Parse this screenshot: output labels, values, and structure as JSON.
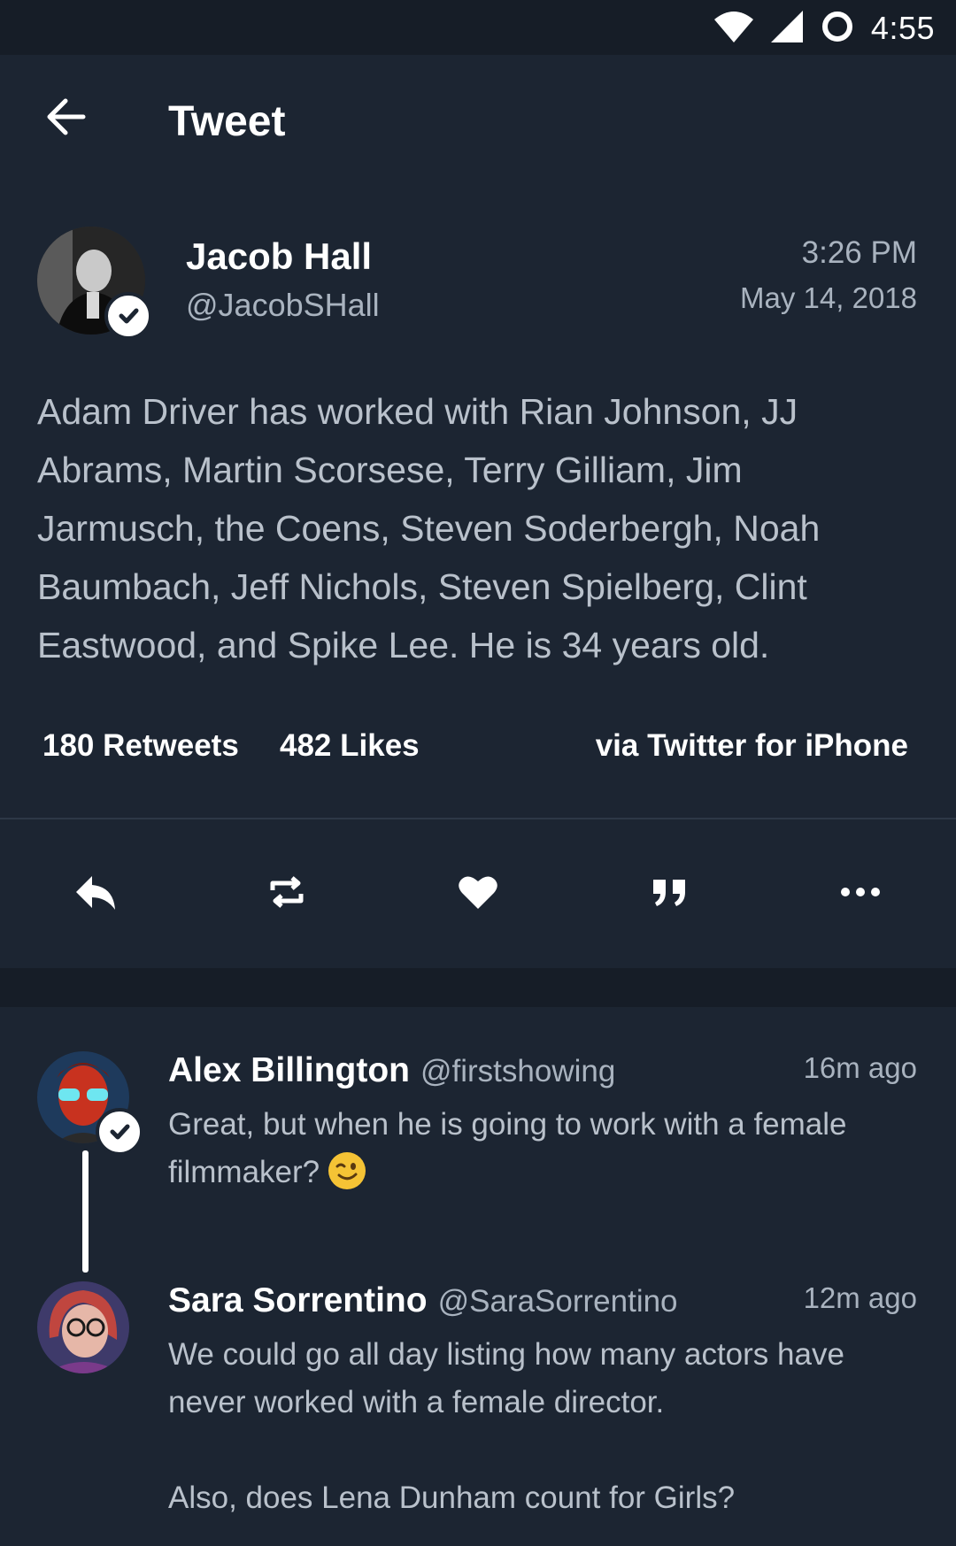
{
  "status_bar": {
    "time": "4:55",
    "icons": [
      "wifi-icon",
      "signal-icon",
      "sync-icon"
    ]
  },
  "header": {
    "title": "Tweet",
    "back_icon": "arrow-left-icon"
  },
  "tweet": {
    "author_name": "Jacob Hall",
    "author_handle": "@JacobSHall",
    "time": "3:26 PM",
    "date": "May 14, 2018",
    "verified": true,
    "text": "Adam Driver has worked with Rian Johnson, JJ Abrams, Martin Scorsese, Terry Gilliam, Jim Jarmusch, the Coens, Steven Soderbergh, Noah Baumbach, Jeff Nichols, Steven Spielberg, Clint Eastwood, and Spike Lee. He is 34 years old.",
    "retweets": "180 Retweets",
    "likes": "482 Likes",
    "source": "via Twitter for iPhone"
  },
  "actions": [
    {
      "icon": "reply-icon"
    },
    {
      "icon": "retweet-icon"
    },
    {
      "icon": "heart-icon"
    },
    {
      "icon": "quote-icon"
    },
    {
      "icon": "more-icon"
    }
  ],
  "replies": [
    {
      "name": "Alex Billington",
      "handle": "@firstshowing",
      "time": "16m ago",
      "verified": true,
      "text": "Great, but when he is going to work with a female filmmaker?"
    },
    {
      "name": "Sara Sorrentino",
      "handle": "@SaraSorrentino",
      "time": "12m ago",
      "verified": false,
      "text": "We could go all day listing how many actors have never worked with a female director.",
      "text2": "Also, does Lena Dunham count for Girls?"
    }
  ],
  "colors": {
    "background": "#1c2532",
    "status_bar": "#161d27",
    "text_primary": "#ffffff",
    "text_secondary": "#a9b3bf",
    "text_body": "#b9c1cb"
  }
}
